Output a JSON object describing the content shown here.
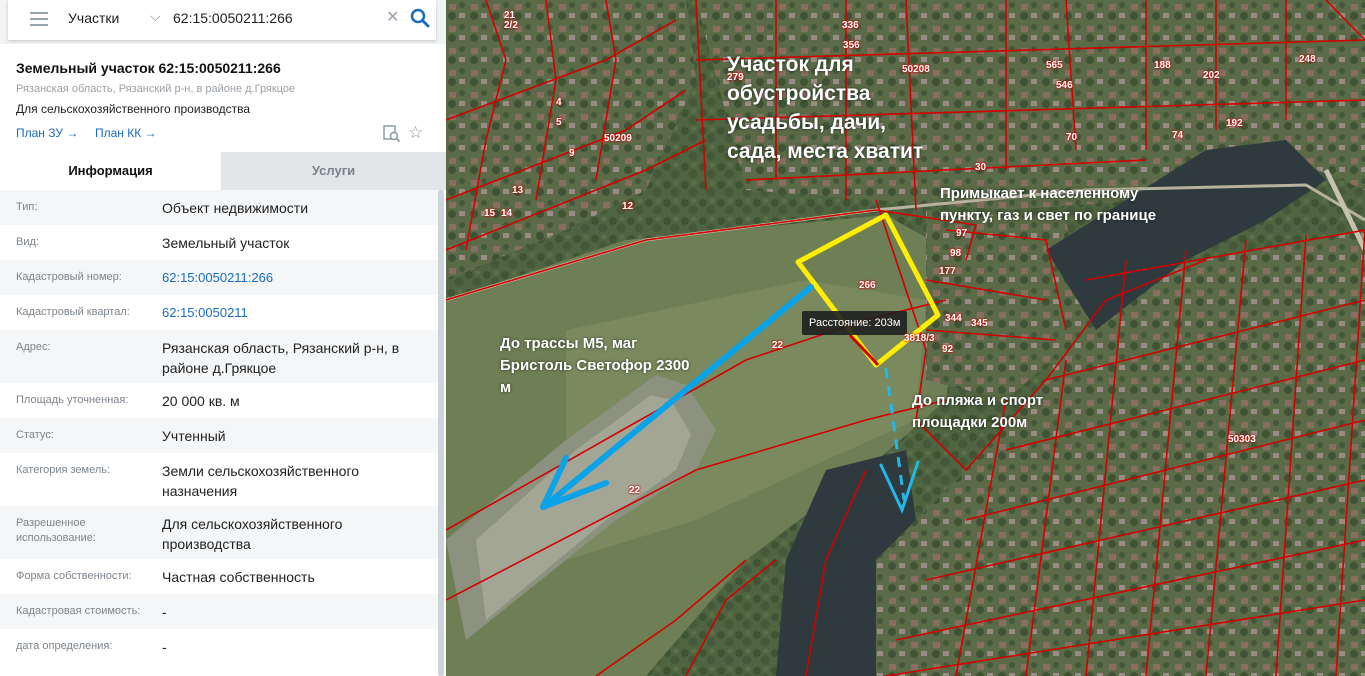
{
  "search": {
    "layer": "Участки",
    "query": "62:15:0050211:266"
  },
  "card": {
    "title": "Земельный участок 62:15:0050211:266",
    "address": "Рязанская область, Рязанский р-н, в районе д.Грякцое",
    "purpose": "Для сельскохозяйственного производства",
    "plan_zu": "План ЗУ →",
    "plan_kk": "План КК →"
  },
  "tabs": {
    "info": "Информация",
    "services": "Услуги"
  },
  "info_rows": [
    {
      "label": "Тип:",
      "value": "Объект недвижимости",
      "link": false
    },
    {
      "label": "Вид:",
      "value": "Земельный участок",
      "link": false
    },
    {
      "label": "Кадастровый номер:",
      "value": "62:15:0050211:266",
      "link": true
    },
    {
      "label": "Кадастровый квартал:",
      "value": "62:15:0050211",
      "link": true
    },
    {
      "label": "Адрес:",
      "value": "Рязанская область, Рязанский р-н, в районе д.Грякцое",
      "link": false
    },
    {
      "label": "Площадь уточненная:",
      "value": "20 000 кв. м",
      "link": false
    },
    {
      "label": "Статус:",
      "value": "Учтенный",
      "link": false
    },
    {
      "label": "Категория земель:",
      "value": "Земли сельскохозяйственного назначения",
      "link": false
    },
    {
      "label": "Разрешенное использование:",
      "value": "Для сельскохозяйственного производства",
      "link": false
    },
    {
      "label": "Форма собственности:",
      "value": "Частная собственность",
      "link": false
    },
    {
      "label": "Кадастровая стоимость:",
      "value": "-",
      "link": false
    },
    {
      "label": "дата определения:",
      "value": "-",
      "link": false
    }
  ],
  "map": {
    "annotations": {
      "purpose": "Участок для обустройства усадьбы, дачи, сада, места хватит",
      "border": "Примыкает к населенному пункту, газ и свет по границе",
      "highway": "До трассы М5, маг Бристоль Светофор 2300 м",
      "beach": "До пляжа и спорт площадки 200м"
    },
    "distance_tooltip": "Расстояние: 203м",
    "parcel_numbers": [
      "266",
      "22",
      "22",
      "97",
      "98",
      "177",
      "344",
      "345",
      "3818/3",
      "92",
      "4",
      "5",
      "9",
      "12",
      "13",
      "14",
      "15",
      "21",
      "2/2",
      "279",
      "356",
      "248",
      "202",
      "30",
      "70",
      "74",
      "192",
      "565",
      "546",
      "188",
      "336"
    ],
    "quarter_labels": [
      "50209",
      "50208",
      "50303"
    ],
    "colors": {
      "parcel_border": "#d40000",
      "selected_parcel": "#ffee00",
      "route_highway": "#0aa3e8",
      "route_beach": "#22b8e8",
      "water": "#2f3a3e"
    }
  }
}
